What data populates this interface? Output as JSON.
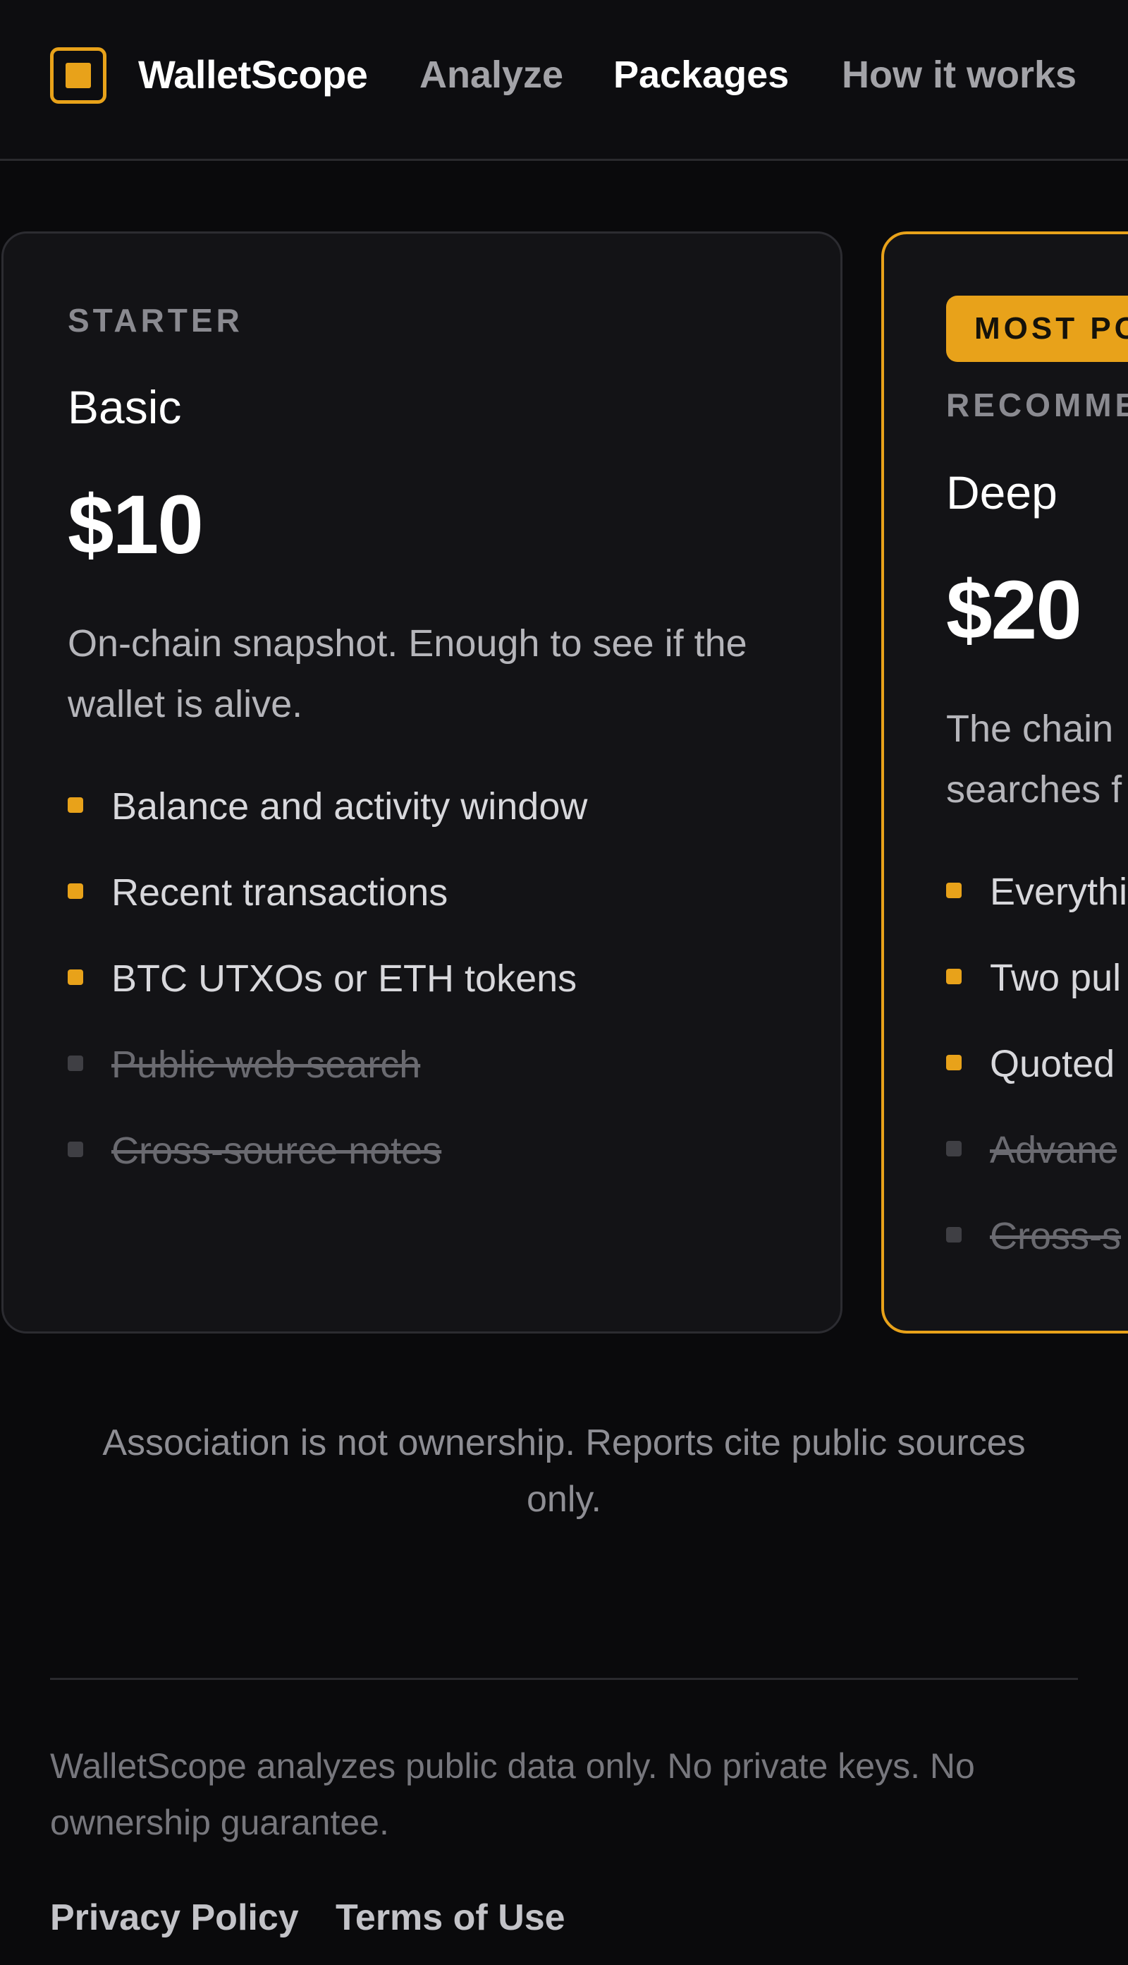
{
  "header": {
    "brand": "WalletScope",
    "logo_icon": "square-logo-icon",
    "nav": {
      "analyze": "Analyze",
      "packages": "Packages",
      "how_it_works": "How it works"
    }
  },
  "plans": {
    "basic": {
      "tier": "STARTER",
      "name": "Basic",
      "price": "$10",
      "description": "On-chain snapshot. Enough to see if the wallet is alive.",
      "features": [
        {
          "text": "Balance and activity window",
          "included": true
        },
        {
          "text": "Recent transactions",
          "included": true
        },
        {
          "text": "BTC UTXOs or ETH tokens",
          "included": true
        },
        {
          "text": "Public web search",
          "included": false
        },
        {
          "text": "Cross-source notes",
          "included": false
        }
      ]
    },
    "deep": {
      "badge": "MOST PO",
      "tier": "RECOMME",
      "name": "Deep",
      "price": "$20",
      "description_line1": "The chain",
      "description_line2": "searches f",
      "features": [
        {
          "text": "Everythi",
          "included": true
        },
        {
          "text": "Two pul",
          "included": true
        },
        {
          "text": "Quoted",
          "included": true
        },
        {
          "text": "Advanc",
          "included": false
        },
        {
          "text": "Cross-s",
          "included": false
        }
      ]
    }
  },
  "note": "Association is not ownership. Reports cite public sources only.",
  "footer": {
    "disclaimer": "WalletScope analyzes public data only. No private keys. No ownership guarantee.",
    "privacy": "Privacy Policy",
    "terms": "Terms of Use"
  },
  "colors": {
    "accent": "#e8a21a",
    "background": "#0a0a0c",
    "card": "#131316"
  }
}
